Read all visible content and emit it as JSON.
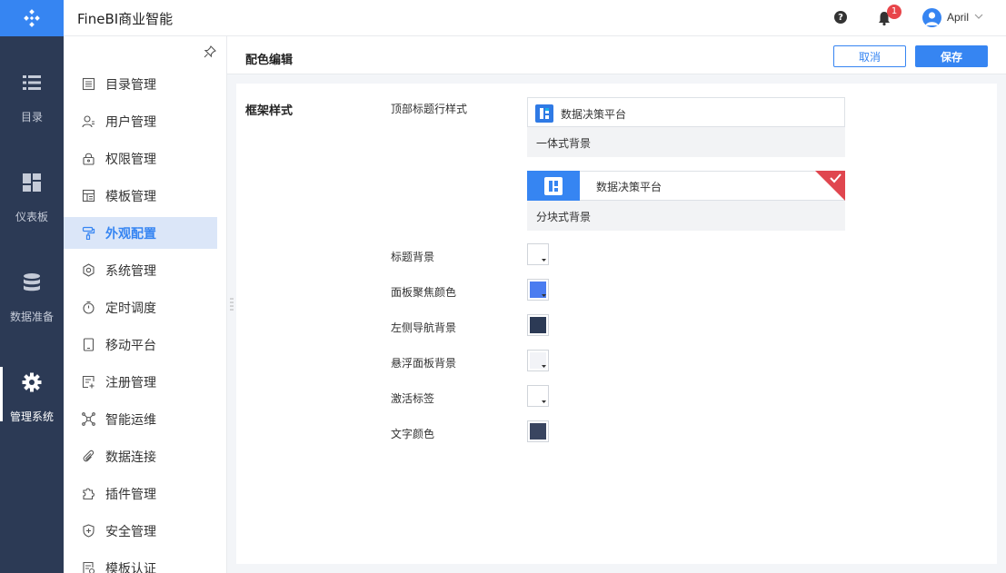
{
  "app": {
    "title": "FineBI商业智能"
  },
  "topbar": {
    "notifications": "1",
    "user": "April"
  },
  "leftnav": [
    {
      "label": "目录",
      "icon": "list-icon"
    },
    {
      "label": "仪表板",
      "icon": "dashboard-icon"
    },
    {
      "label": "数据准备",
      "icon": "database-icon"
    },
    {
      "label": "管理系统",
      "icon": "gear-icon",
      "active": true
    }
  ],
  "submenu": [
    {
      "label": "目录管理",
      "icon": "catalog-icon"
    },
    {
      "label": "用户管理",
      "icon": "user-icon"
    },
    {
      "label": "权限管理",
      "icon": "lock-icon"
    },
    {
      "label": "模板管理",
      "icon": "template-icon"
    },
    {
      "label": "外观配置",
      "icon": "paint-roller-icon",
      "active": true
    },
    {
      "label": "系统管理",
      "icon": "settings-icon"
    },
    {
      "label": "定时调度",
      "icon": "timer-icon"
    },
    {
      "label": "移动平台",
      "icon": "mobile-icon"
    },
    {
      "label": "注册管理",
      "icon": "register-icon"
    },
    {
      "label": "智能运维",
      "icon": "network-icon"
    },
    {
      "label": "数据连接",
      "icon": "link-icon"
    },
    {
      "label": "插件管理",
      "icon": "plugin-icon"
    },
    {
      "label": "安全管理",
      "icon": "shield-icon"
    },
    {
      "label": "模板认证",
      "icon": "certify-icon"
    }
  ],
  "content": {
    "title": "配色编辑",
    "cancel_label": "取消",
    "save_label": "保存",
    "section": "框架样式",
    "header_style_label": "顶部标题行样式",
    "brand_text": "数据决策平台",
    "option1_caption": "一体式背景",
    "option2_caption": "分块式背景",
    "selected_option": "分块式背景",
    "fields": [
      {
        "label": "标题背景",
        "color": "#ffffff"
      },
      {
        "label": "面板聚焦颜色",
        "color": "#4a7cf0"
      },
      {
        "label": "左侧导航背景",
        "color": "#2c3a55"
      },
      {
        "label": "悬浮面板背景",
        "color": "#f2f3f7"
      },
      {
        "label": "激活标签",
        "color": "#ffffff"
      },
      {
        "label": "文字颜色",
        "color": "#394560"
      }
    ]
  },
  "colors": {
    "accent": "#3685f2",
    "nav_bg": "#2c3a55",
    "check_red": "#e0464f"
  }
}
